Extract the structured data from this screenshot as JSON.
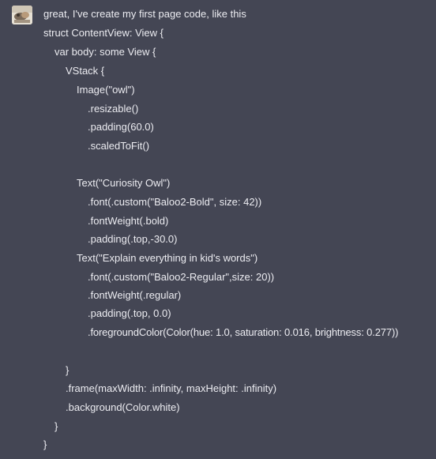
{
  "message": {
    "lines": [
      {
        "text": "great, I've create my first page code, like this"
      },
      {
        "text": "struct ContentView: View {"
      },
      {
        "text": "var body: some View {"
      },
      {
        "text": "VStack {"
      },
      {
        "text": "Image(\"owl\")"
      },
      {
        "text": ".resizable()"
      },
      {
        "text": ".padding(60.0)"
      },
      {
        "text": ".scaledToFit()"
      },
      {
        "text": ""
      },
      {
        "text": "Text(\"Curiosity Owl\")"
      },
      {
        "text": ".font(.custom(\"Baloo2-Bold\", size: 42))"
      },
      {
        "text": ".fontWeight(.bold)"
      },
      {
        "text": ".padding(.top,-30.0)"
      },
      {
        "text": "Text(\"Explain everything in kid's words\")"
      },
      {
        "text": ".font(.custom(\"Baloo2-Regular\",size: 20))"
      },
      {
        "text": ".fontWeight(.regular)"
      },
      {
        "text": ".padding(.top, 0.0)"
      },
      {
        "text": ".foregroundColor(Color(hue: 1.0, saturation: 0.016, brightness: 0.277))"
      },
      {
        "text": ""
      },
      {
        "text": "}"
      },
      {
        "text": ".frame(maxWidth: .infinity, maxHeight: .infinity)"
      },
      {
        "text": ".background(Color.white)"
      },
      {
        "text": "}"
      },
      {
        "text": "}"
      }
    ]
  },
  "colors": {
    "background": "#444654",
    "text": "#ececf1"
  },
  "icons": {
    "avatar": "user-avatar-photo"
  }
}
